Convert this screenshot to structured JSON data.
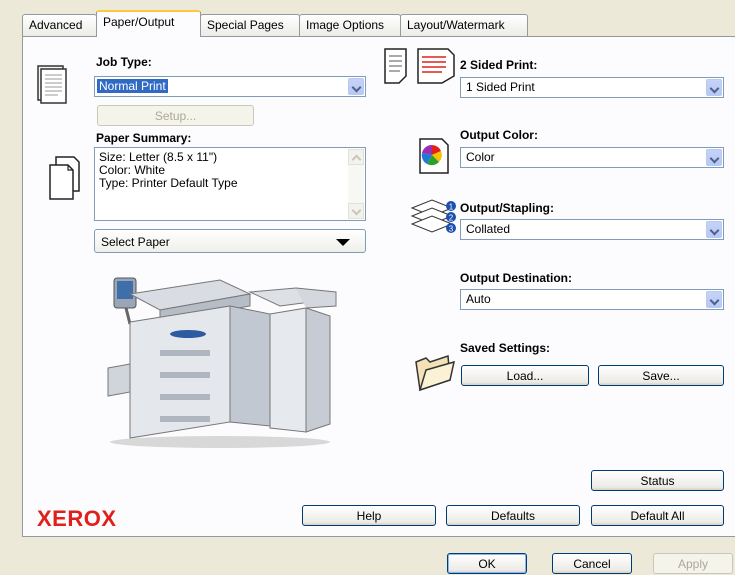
{
  "tabs": [
    {
      "label": "Advanced",
      "active": false
    },
    {
      "label": "Paper/Output",
      "active": true
    },
    {
      "label": "Special Pages",
      "active": false
    },
    {
      "label": "Image Options",
      "active": false
    },
    {
      "label": "Layout/Watermark",
      "active": false
    }
  ],
  "job_type": {
    "label": "Job Type:",
    "value": "Normal Print",
    "icon": "document-icon"
  },
  "setup_button": "Setup...",
  "paper_summary": {
    "label": "Paper Summary:",
    "lines": [
      "Size: Letter (8.5 x 11\")",
      "Color: White",
      "Type: Printer Default Type"
    ],
    "icon": "paper-stack-icon"
  },
  "select_paper": "Select Paper",
  "two_sided": {
    "label": "2 Sided Print:",
    "value": "1 Sided Print",
    "icon": "two-sided-print-icon"
  },
  "output_color": {
    "label": "Output Color:",
    "value": "Color",
    "icon": "color-output-icon"
  },
  "output_stapling": {
    "label": "Output/Stapling:",
    "value": "Collated",
    "icon": "collated-stack-icon"
  },
  "output_destination": {
    "label": "Output Destination:",
    "value": "Auto"
  },
  "saved_settings": {
    "label": "Saved Settings:",
    "load": "Load...",
    "save": "Save...",
    "icon": "folder-icon"
  },
  "printer_image": "printer-illustration",
  "brand": "XEROX",
  "buttons": {
    "status": "Status",
    "help": "Help",
    "defaults": "Defaults",
    "default_all": "Default All"
  },
  "dialog_buttons": {
    "ok": "OK",
    "cancel": "Cancel",
    "apply": "Apply"
  },
  "colors": {
    "brand": "#e0201b",
    "selection": "#316ac5",
    "window": "#ece9d8"
  }
}
